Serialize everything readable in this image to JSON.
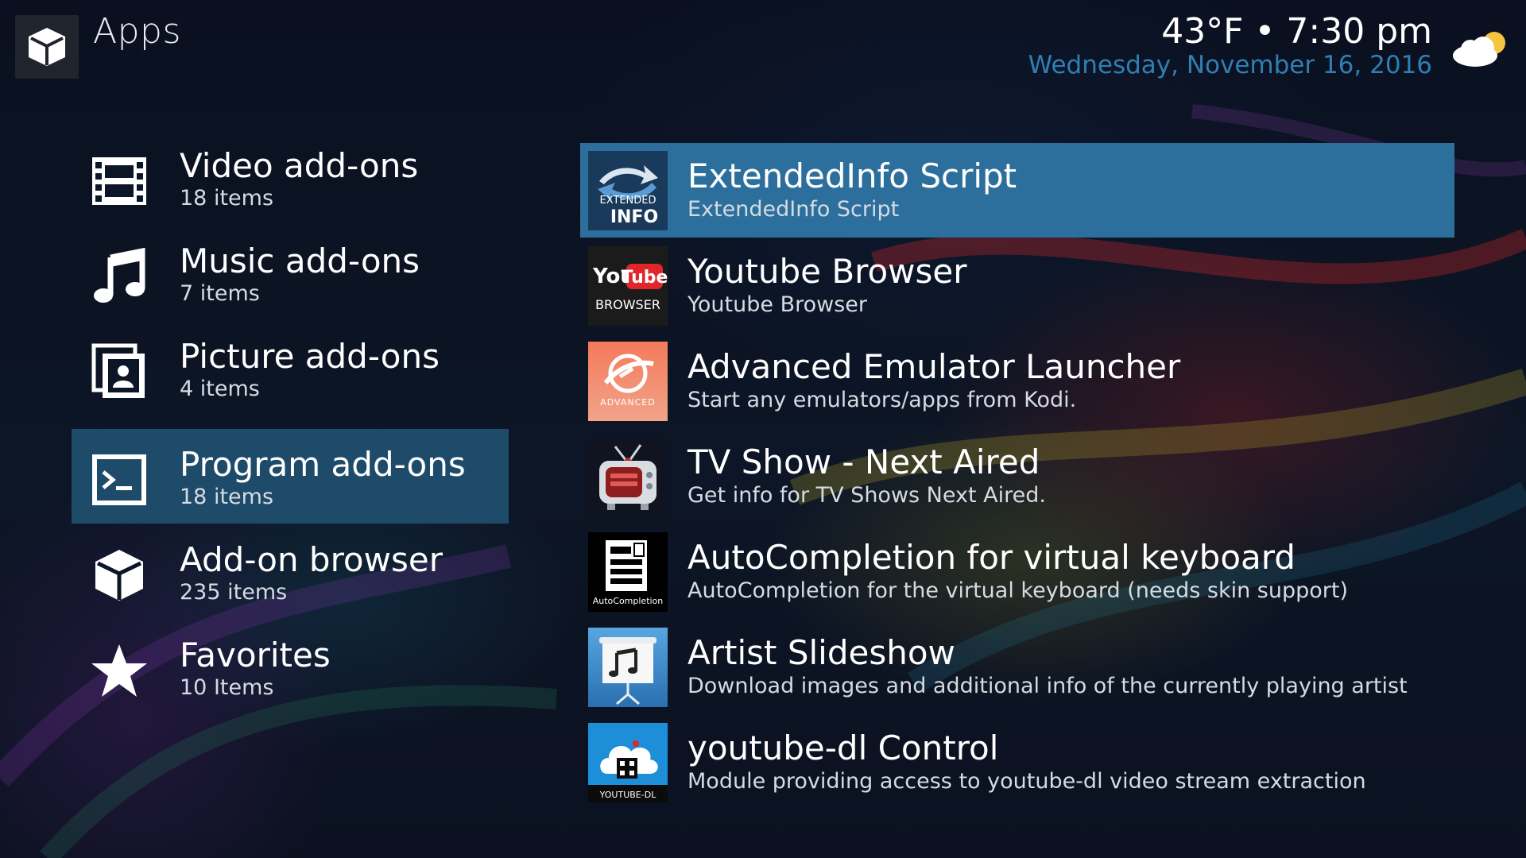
{
  "header": {
    "app_icon": "package-icon",
    "title": "Apps",
    "weather": "43°F • 7:30 pm",
    "date": "Wednesday, November 16, 2016",
    "weather_icon": "partly-cloudy-icon"
  },
  "categories": [
    {
      "icon": "film-icon",
      "title": "Video add-ons",
      "count": "18 items",
      "selected": false
    },
    {
      "icon": "music-note-icon",
      "title": "Music add-ons",
      "count": "7 items",
      "selected": false
    },
    {
      "icon": "picture-icon",
      "title": "Picture add-ons",
      "count": "4 items",
      "selected": false
    },
    {
      "icon": "terminal-icon",
      "title": "Program add-ons",
      "count": "18 items",
      "selected": true
    },
    {
      "icon": "package-icon",
      "title": "Add-on browser",
      "count": "235 items",
      "selected": false
    },
    {
      "icon": "star-icon",
      "title": "Favorites",
      "count": "10 Items",
      "selected": false
    }
  ],
  "addons": [
    {
      "title": "ExtendedInfo Script",
      "description": "ExtendedInfo Script",
      "selected": true,
      "thumb": {
        "name": "extendedinfo-thumb",
        "line1": "EXTENDED",
        "line2": "INFO"
      }
    },
    {
      "title": "Youtube Browser",
      "description": "Youtube Browser",
      "selected": false,
      "thumb": {
        "name": "youtube-browser-thumb",
        "line1": "You",
        "line2": "Tube",
        "line3": "BROWSER"
      }
    },
    {
      "title": "Advanced Emulator Launcher",
      "description": "Start any emulators/apps from Kodi.",
      "selected": false,
      "thumb": {
        "name": "advanced-emulator-launcher-thumb",
        "line1": "ADVANCED"
      }
    },
    {
      "title": "TV Show - Next Aired",
      "description": "Get info for TV Shows Next Aired.",
      "selected": false,
      "thumb": {
        "name": "tv-show-next-aired-thumb"
      }
    },
    {
      "title": "AutoCompletion for virtual keyboard",
      "description": "AutoCompletion for the virtual keyboard (needs skin support)",
      "selected": false,
      "thumb": {
        "name": "autocompletion-thumb",
        "line1": "AutoCompletion"
      }
    },
    {
      "title": "Artist Slideshow",
      "description": "Download images and additional info of the currently playing artist",
      "selected": false,
      "thumb": {
        "name": "artist-slideshow-thumb"
      }
    },
    {
      "title": "youtube-dl Control",
      "description": "Module providing access to youtube-dl video stream extraction",
      "selected": false,
      "thumb": {
        "name": "youtube-dl-thumb",
        "line1": "YOUTUBE-DL"
      }
    }
  ],
  "colors": {
    "selected_category": "#1f4b6b",
    "selected_addon": "#2c6f9c",
    "date_text": "#2f7fb4"
  }
}
